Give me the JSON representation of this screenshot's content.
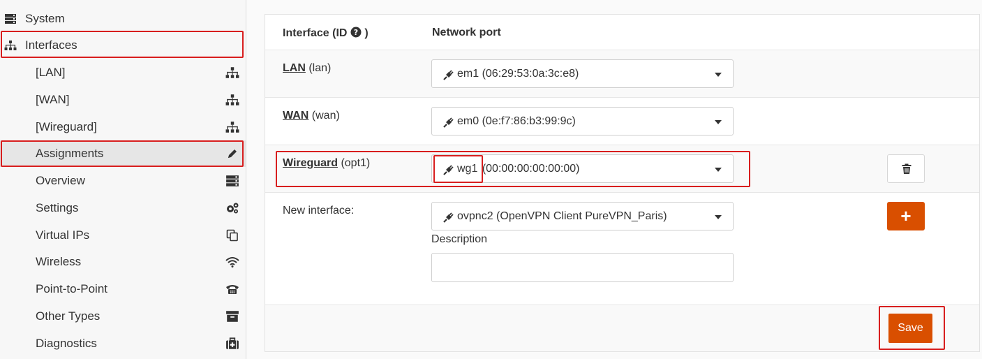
{
  "sidebar": {
    "top_items": [
      {
        "label": "System",
        "icon": "server-icon"
      },
      {
        "label": "Interfaces",
        "icon": "sitemap-icon"
      }
    ],
    "sub_items": [
      {
        "label": "[LAN]",
        "icon": "sitemap-icon"
      },
      {
        "label": "[WAN]",
        "icon": "sitemap-icon"
      },
      {
        "label": "[Wireguard]",
        "icon": "sitemap-icon"
      },
      {
        "label": "Assignments",
        "icon": "pencil-icon"
      },
      {
        "label": "Overview",
        "icon": "list-icon"
      },
      {
        "label": "Settings",
        "icon": "cogs-icon"
      },
      {
        "label": "Virtual IPs",
        "icon": "copy-icon"
      },
      {
        "label": "Wireless",
        "icon": "wifi-icon"
      },
      {
        "label": "Point-to-Point",
        "icon": "phone-icon"
      },
      {
        "label": "Other Types",
        "icon": "archive-icon"
      },
      {
        "label": "Diagnostics",
        "icon": "medkit-icon"
      }
    ]
  },
  "table": {
    "headers": {
      "interface": "Interface (ID",
      "interface_suffix": ")",
      "port": "Network port"
    },
    "rows": [
      {
        "name": "LAN",
        "id": "(lan)",
        "port": "em1 (06:29:53:0a:3c:e8)"
      },
      {
        "name": "WAN",
        "id": "(wan)",
        "port": "em0 (0e:f7:86:b3:99:9c)"
      },
      {
        "name": "Wireguard",
        "id": "(opt1)",
        "port_name": "wg1",
        "port_mac": "(00:00:00:00:00:00)"
      }
    ],
    "new_interface": {
      "label": "New interface:",
      "port": "ovpnc2 (OpenVPN Client PureVPN_Paris)",
      "description_label": "Description",
      "description_value": ""
    }
  },
  "buttons": {
    "add": "+",
    "save": "Save"
  },
  "colors": {
    "accent": "#d94f00",
    "highlight": "#d81e1e"
  }
}
